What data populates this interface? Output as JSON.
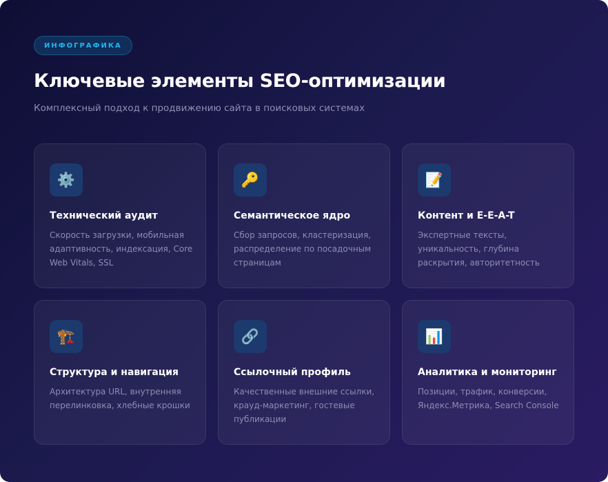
{
  "badge": "ИНФОГРАФИКА",
  "title": "Ключевые элементы SEO-оптимизации",
  "subtitle": "Комплексный подход к продвижению сайта в поисковых системах",
  "cards": [
    {
      "icon": "⚙️",
      "icon_name": "gear",
      "title": "Технический аудит",
      "desc": "Скорость загрузки, мобильная адаптивность, индексация, Core Web Vitals, SSL"
    },
    {
      "icon": "🔑",
      "icon_name": "key",
      "title": "Семантическое ядро",
      "desc": "Сбор запросов, кластеризация, распределение по посадочным страницам"
    },
    {
      "icon": "📝",
      "icon_name": "memo",
      "title": "Контент и E-E-A-T",
      "desc": "Экспертные тексты, уникальность, глубина раскрытия, авторитетность"
    },
    {
      "icon": "🏗️",
      "icon_name": "construction",
      "title": "Структура и навигация",
      "desc": "Архитектура URL, внутренняя перелинковка, хлебные крошки"
    },
    {
      "icon": "🔗",
      "icon_name": "link",
      "title": "Ссылочный профиль",
      "desc": "Качественные внешние ссылки, крауд-маркетинг, гостевые публикации"
    },
    {
      "icon": "📊",
      "icon_name": "bar-chart",
      "title": "Аналитика и мониторинг",
      "desc": "Позиции, трафик, конверсии, Яндекс.Метрика, Search Console"
    }
  ]
}
